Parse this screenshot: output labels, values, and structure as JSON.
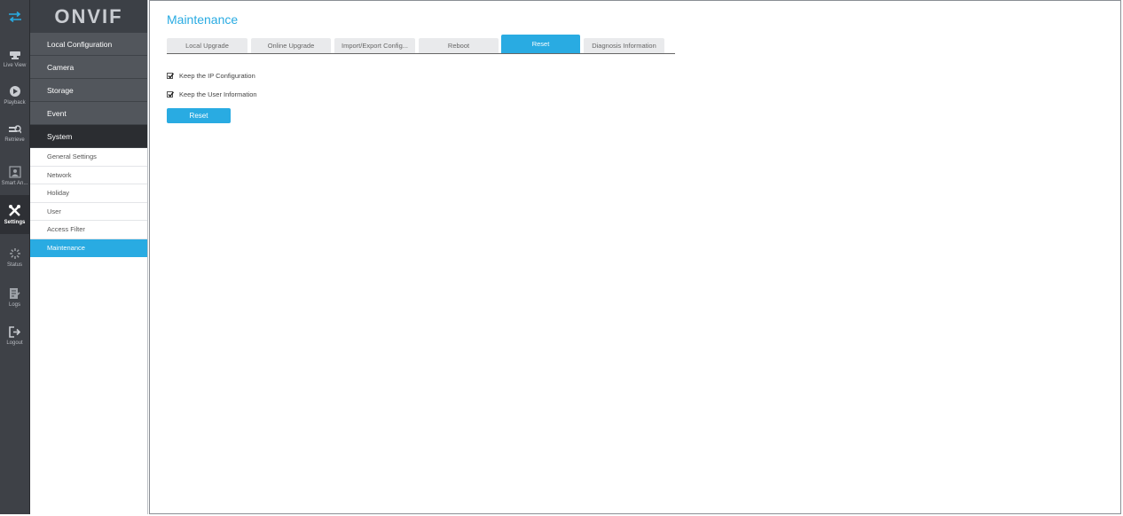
{
  "rail": {
    "items": [
      {
        "label": "Live View",
        "icon": "live-view-icon"
      },
      {
        "label": "Playback",
        "icon": "playback-icon"
      },
      {
        "label": "Retrieve",
        "icon": "retrieve-icon"
      },
      {
        "label": "Smart An...",
        "icon": "smart-analytics-icon"
      },
      {
        "label": "Settings",
        "icon": "settings-icon"
      },
      {
        "label": "Status",
        "icon": "status-icon"
      },
      {
        "label": "Logs",
        "icon": "logs-icon"
      },
      {
        "label": "Logout",
        "icon": "logout-icon"
      }
    ]
  },
  "logo": "ONVIF",
  "menu": {
    "categories": [
      "Local Configuration",
      "Camera",
      "Storage",
      "Event",
      "System"
    ],
    "sub_items": [
      "General Settings",
      "Network",
      "Holiday",
      "User",
      "Access Filter",
      "Maintenance"
    ]
  },
  "page": {
    "title": "Maintenance",
    "tabs": [
      "Local Upgrade",
      "Online Upgrade",
      "Import/Export Config...",
      "Reboot",
      "Reset",
      "Diagnosis Information"
    ],
    "active_tab": "Reset",
    "options": [
      {
        "label": "Keep the IP Configuration",
        "checked": true
      },
      {
        "label": "Keep the User Information",
        "checked": true
      }
    ],
    "reset_button": "Reset"
  },
  "colors": {
    "accent": "#29abe2",
    "rail_bg": "#3e4147",
    "menu_dark": "#2b2d31"
  }
}
